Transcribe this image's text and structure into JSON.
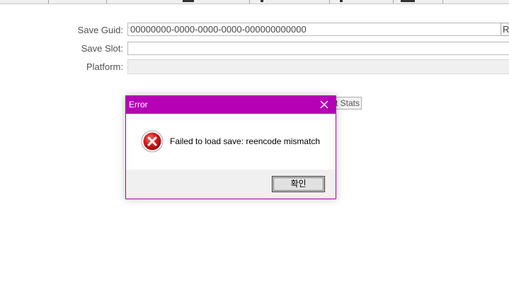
{
  "form": {
    "save_guid_label": "Save Guid:",
    "save_guid_value": "00000000-0000-0000-0000-000000000000",
    "random_button_label": "Ra",
    "save_slot_label": "Save Slot:",
    "save_slot_value": "",
    "platform_label": "Platform:",
    "platform_value": "",
    "stats_button_label": "t Stats"
  },
  "dialog": {
    "title": "Error",
    "message": "Failed to load save: reencode mismatch",
    "ok_label": "확인",
    "titlebar_color": "#b500b5",
    "icon": "error-icon",
    "close_icon": "close-icon"
  }
}
